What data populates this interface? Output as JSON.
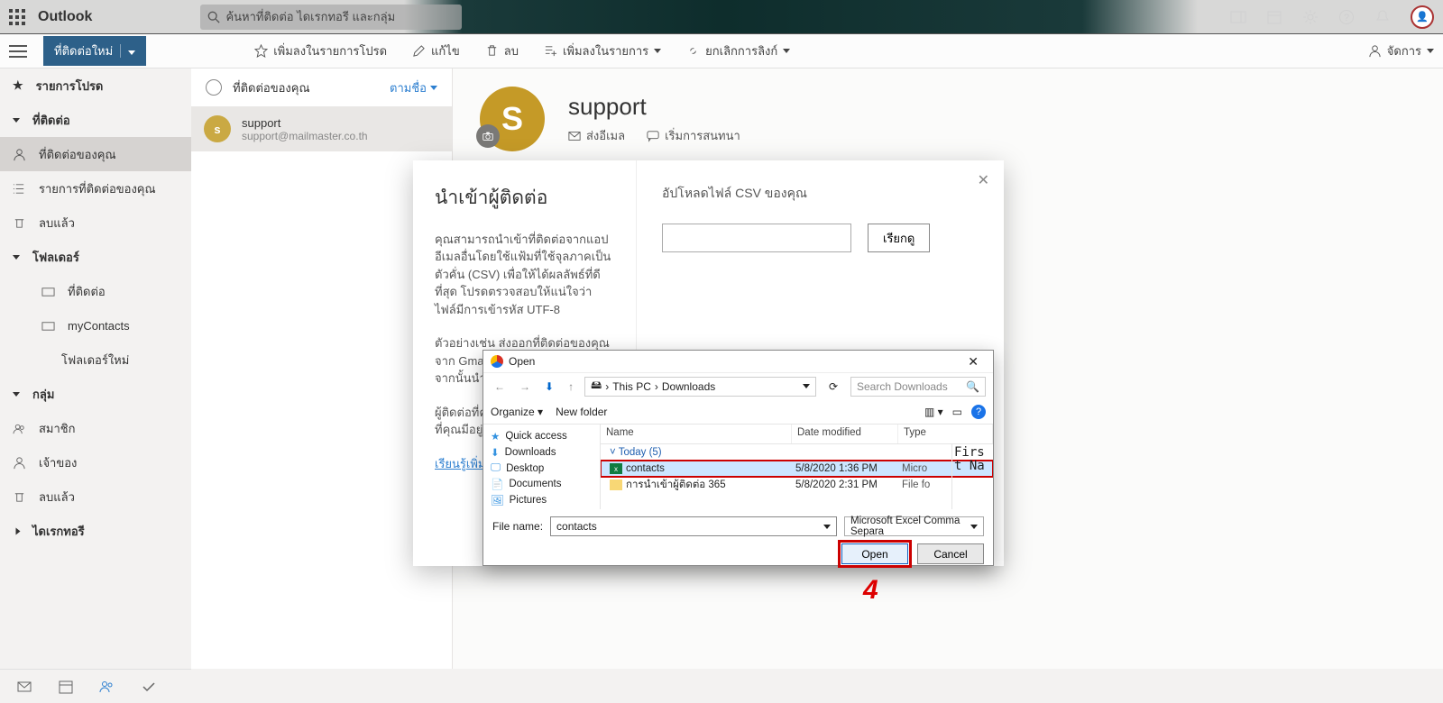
{
  "header": {
    "brand": "Outlook",
    "search_placeholder": "ค้นหาที่ติดต่อ ไดเรกทอรี และกลุ่ม"
  },
  "toolbar": {
    "new_contact": "ที่ติดต่อใหม่",
    "favorite": "เพิ่มลงในรายการโปรด",
    "edit": "แก้ไข",
    "delete": "ลบ",
    "add_to_list": "เพิ่มลงในรายการ",
    "remove_link": "ยกเลิกการลิงก์",
    "manage": "จัดการ"
  },
  "sidebar": {
    "favorites": "รายการโปรด",
    "contacts_header": "ที่ติดต่อ",
    "your_contacts": "ที่ติดต่อของคุณ",
    "your_lists": "รายการที่ติดต่อของคุณ",
    "deleted": "ลบแล้ว",
    "folders_header": "โฟลเดอร์",
    "folder_contacts": "ที่ติดต่อ",
    "folder_my": "myContacts",
    "new_folder": "โฟลเดอร์ใหม่",
    "groups_header": "กลุ่ม",
    "member": "สมาชิก",
    "owner": "เจ้าของ",
    "groups_deleted": "ลบแล้ว",
    "directory": "ไดเรกทอรี"
  },
  "contact_list": {
    "header": "ที่ติดต่อของคุณ",
    "sort": "ตามชื่อ",
    "item": {
      "initial": "s",
      "name": "support",
      "email": "support@mailmaster.co.th"
    }
  },
  "detail": {
    "initial": "S",
    "name": "support",
    "send_email": "ส่งอีเมล",
    "start_chat": "เริ่มการสนทนา"
  },
  "import_modal": {
    "title": "นำเข้าผู้ติดต่อ",
    "para1": "คุณสามารถนำเข้าที่ติดต่อจากแอปอีเมลอื่นโดยใช้แฟ้มที่ใช้จุลภาคเป็นตัวคั่น (CSV) เพื่อให้ได้ผลลัพธ์ที่ดีที่สุด โปรดตรวจสอบให้แน่ใจว่า ไฟล์มีการเข้ารหัส UTF-8",
    "para2": "ตัวอย่างเช่น ส่งออกที่ติดต่อของคุณจาก Gmail ในรูปแบบ CSV และจากนั้นนำเข้าที่ติดต่อไปยัง Outlook",
    "para3_a": "ผู้ติดต่อที่คุ",
    "para3_b": "ที่คุณมีอยู่",
    "learn_more": "เรียนรู้เพิ่มเติ",
    "upload_label": "อัปโหลดไฟล์ CSV ของคุณ",
    "browse": "เรียกดู"
  },
  "win": {
    "title": "Open",
    "path_pc": "This PC",
    "path_folder": "Downloads",
    "search_hint": "Search Downloads",
    "organize": "Organize",
    "new_folder": "New folder",
    "col_name": "Name",
    "col_date": "Date modified",
    "col_type": "Type",
    "group": "Today (5)",
    "rows": [
      {
        "name": "contacts",
        "date": "5/8/2020 1:36 PM",
        "type": "Micro"
      },
      {
        "name": "การนำเข้าผู้ติดต่อ 365",
        "date": "5/8/2020 2:31 PM",
        "type": "File fo"
      }
    ],
    "tree": {
      "quick": "Quick access",
      "downloads": "Downloads",
      "desktop": "Desktop",
      "documents": "Documents",
      "pictures": "Pictures"
    },
    "preview": "First Na",
    "file_name_label": "File name:",
    "file_name_value": "contacts",
    "filter": "Microsoft Excel Comma Separa",
    "open": "Open",
    "cancel": "Cancel"
  },
  "annotation": "4"
}
